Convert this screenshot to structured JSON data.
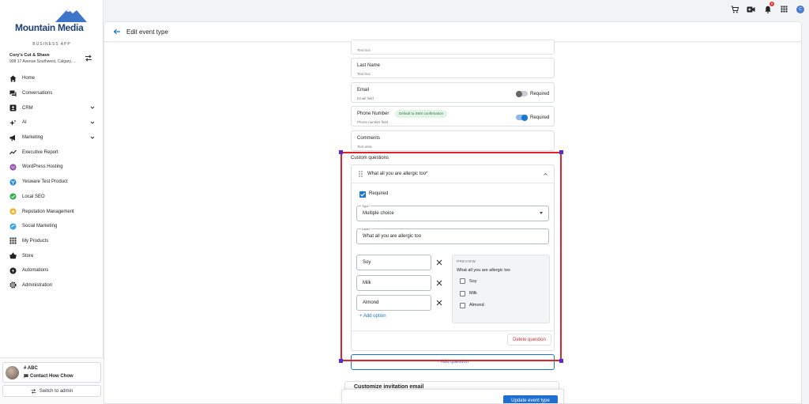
{
  "brand": {
    "name": "Mountain Media",
    "subtitle": "BUSINESS APP",
    "color": "#1f3f77"
  },
  "business": {
    "name": "Cory's Cut & Shave",
    "address": "908 17 Avenue Southwest, Calgary, ..."
  },
  "sidebar": {
    "items": [
      {
        "label": "Home",
        "icon": "home-icon"
      },
      {
        "label": "Conversations",
        "icon": "chat-icon"
      },
      {
        "label": "CRM",
        "icon": "contacts-icon",
        "expandable": true
      },
      {
        "label": "AI",
        "icon": "sparkle-icon",
        "expandable": true
      },
      {
        "label": "Marketing",
        "icon": "megaphone-icon",
        "expandable": true
      },
      {
        "label": "Executive Report",
        "icon": "trend-icon"
      },
      {
        "label": "WordPress Hosting",
        "icon": "wordpress-icon"
      },
      {
        "label": "Yesware Test Product",
        "icon": "yesware-icon"
      },
      {
        "label": "Local SEO",
        "icon": "seo-icon"
      },
      {
        "label": "Reputation Management",
        "icon": "star-icon"
      },
      {
        "label": "Social Marketing",
        "icon": "social-icon"
      },
      {
        "label": "My Products",
        "icon": "grid-icon"
      },
      {
        "label": "Store",
        "icon": "basket-icon"
      },
      {
        "label": "Automations",
        "icon": "bolt-icon"
      },
      {
        "label": "Administration",
        "icon": "gear-icon"
      }
    ]
  },
  "user": {
    "name": "# ABC",
    "contact": "Contact How Chow",
    "switch_label": "Switch to admin"
  },
  "topbar": {
    "notification_count": "8",
    "user_initial": "C"
  },
  "page": {
    "title": "Edit event type"
  },
  "fields": [
    {
      "label": "",
      "sub": "Text box"
    },
    {
      "label": "Last Name",
      "sub": "Text box"
    },
    {
      "label": "Email",
      "sub": "Email field",
      "required_label": "Required",
      "required": false
    },
    {
      "label": "Phone Number",
      "sub": "Phone number field",
      "chip": "Default to SMS confirmation",
      "required_label": "Required",
      "required": true
    },
    {
      "label": "Comments",
      "sub": "Text area"
    }
  ],
  "custom_questions": {
    "heading": "Custom questions",
    "question_title": "What all you are allergic too*",
    "required_label": "Required",
    "type_label": "Type *",
    "type_value": "Multiple choice",
    "label_label": "Label *",
    "label_value": "What all you are allergic too",
    "options": [
      "Soy",
      "Milk",
      "Almond"
    ],
    "add_option": "+  Add option",
    "preview": {
      "title": "PREVIEW",
      "question": "What all you are allergic too",
      "options": [
        "Soy",
        "Milk",
        "Almond"
      ]
    },
    "delete_label": "Delete question",
    "add_question": "+   Add question"
  },
  "invite": {
    "label": "Customize invitation email"
  },
  "footer": {
    "update_label": "Update event type"
  },
  "colors": {
    "accent": "#1976d2",
    "danger": "#d32f2f",
    "selection": "#e0242c"
  }
}
